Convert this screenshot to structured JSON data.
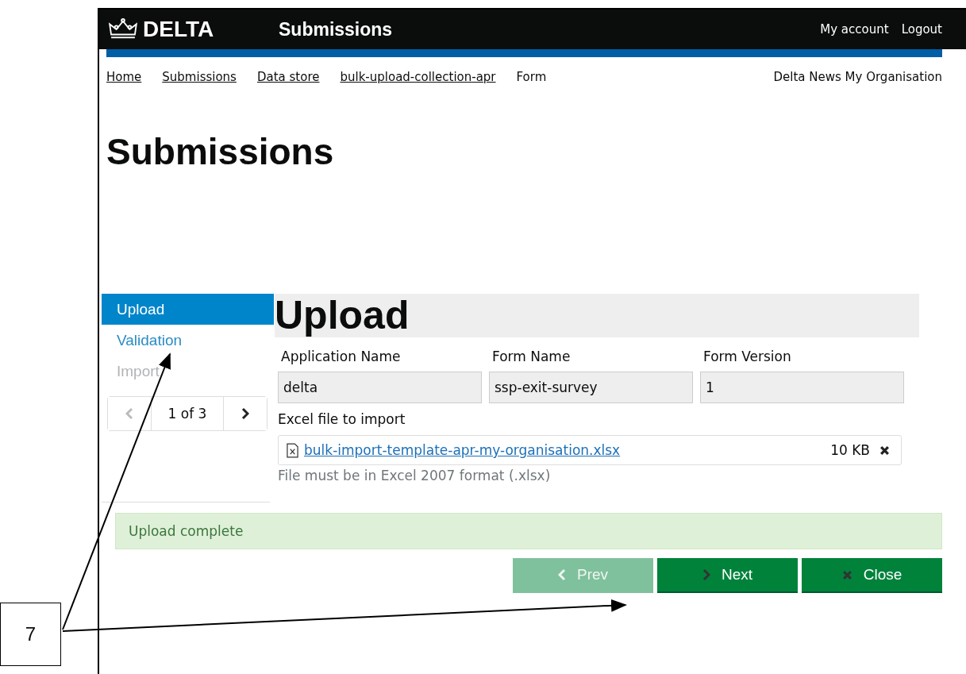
{
  "header": {
    "brand": "DELTA",
    "title": "Submissions",
    "links": [
      "My account",
      "Logout"
    ]
  },
  "breadcrumbs": [
    {
      "label": "Home",
      "link": true
    },
    {
      "label": "Submissions",
      "link": true
    },
    {
      "label": "Data store",
      "link": true
    },
    {
      "label": "bulk-upload-collection-apr",
      "link": true
    },
    {
      "label": "Form",
      "link": false
    }
  ],
  "organisation": "Delta News My Organisation",
  "page_title": "Submissions",
  "steps": [
    {
      "label": "Upload",
      "selected": true,
      "disabled": false
    },
    {
      "label": "Validation",
      "selected": false,
      "disabled": false
    },
    {
      "label": "Import",
      "selected": false,
      "disabled": true
    }
  ],
  "pager": {
    "text": "1 of 3",
    "prev_disabled": true,
    "next_disabled": false
  },
  "form": {
    "heading": "Upload",
    "fields": [
      {
        "label": "Application Name",
        "value": "delta"
      },
      {
        "label": "Form Name",
        "value": "ssp-exit-survey"
      },
      {
        "label": "Form Version",
        "value": "1"
      }
    ],
    "file_label": "Excel file to import",
    "file_name": "bulk-import-template-apr-my-organisation.xlsx",
    "file_size": "10 KB",
    "hint": "File must be in Excel 2007 format (.xlsx)"
  },
  "alert": "Upload complete",
  "buttons": [
    {
      "label": "Prev",
      "kind": "prev",
      "disabled": true
    },
    {
      "label": "Next",
      "kind": "next",
      "disabled": false
    },
    {
      "label": "Close",
      "kind": "close",
      "disabled": false
    }
  ],
  "callout": "7"
}
